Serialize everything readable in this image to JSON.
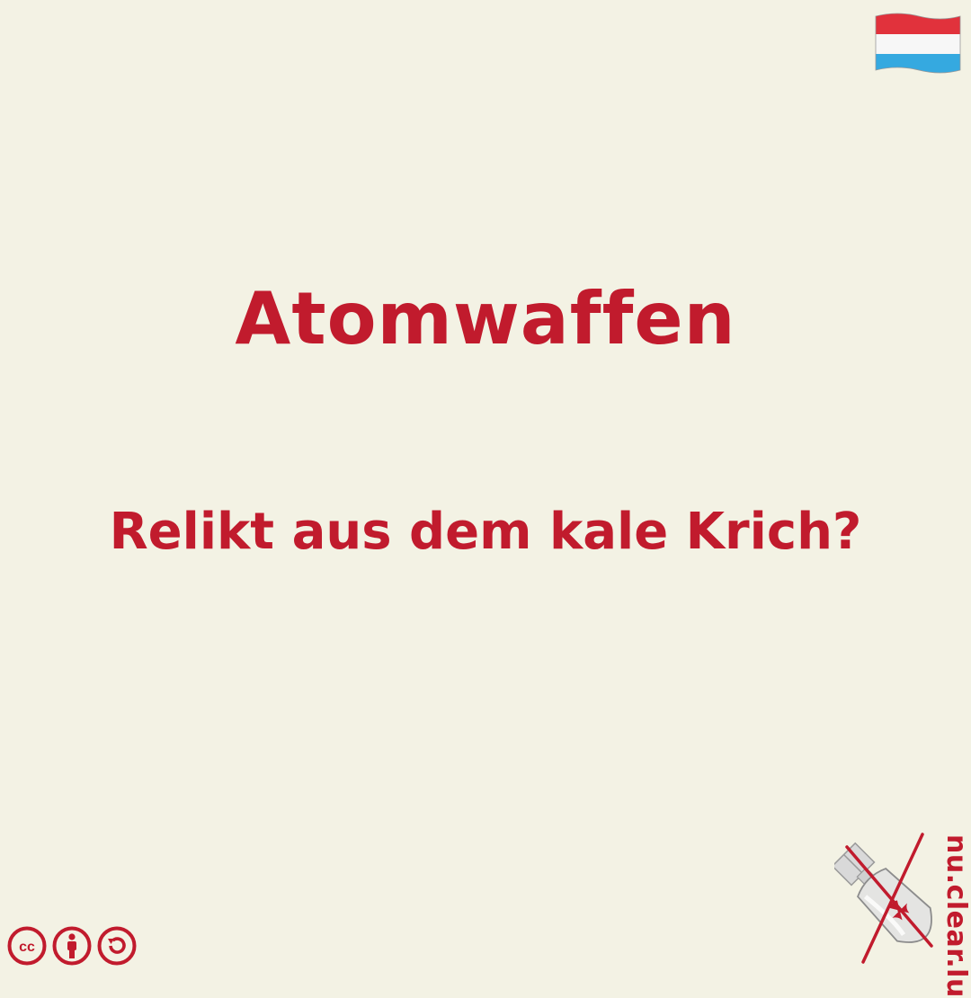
{
  "colors": {
    "background": "#f3f2e4",
    "accent": "#c11b2d"
  },
  "flag": {
    "icon": "luxembourg-flag-icon"
  },
  "headline": "Atomwaffen",
  "subheadline": "Relikt aus dem kale Krich?",
  "license": {
    "icons": [
      "cc-icon",
      "by-icon",
      "sa-icon"
    ],
    "cc_text": "cc"
  },
  "brand": {
    "logo_icon": "crossed-bomb-icon",
    "url": "nu.clear.lu"
  }
}
